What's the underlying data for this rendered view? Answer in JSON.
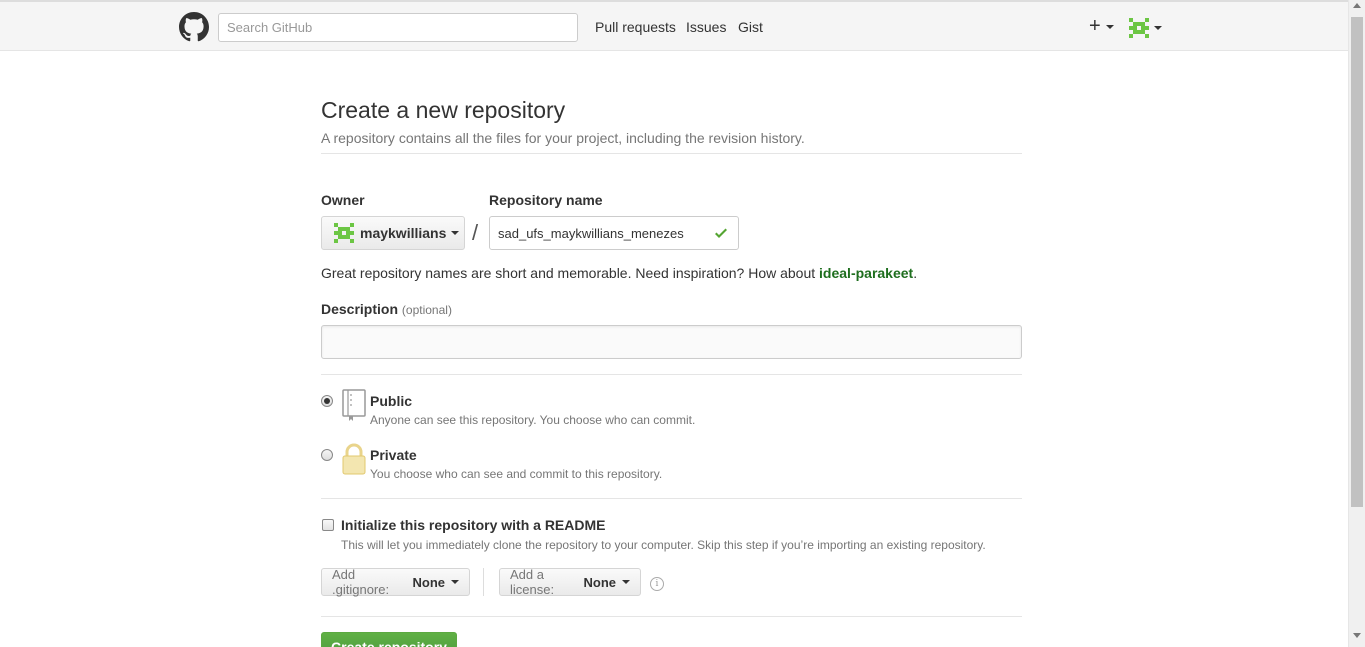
{
  "header": {
    "search_placeholder": "Search GitHub",
    "nav": [
      "Pull requests",
      "Issues",
      "Gist"
    ],
    "plus_label": "+"
  },
  "page": {
    "title": "Create a new repository",
    "subtitle": "A repository contains all the files for your project, including the revision history."
  },
  "owner": {
    "label": "Owner",
    "value": "maykwillians"
  },
  "repo": {
    "label": "Repository name",
    "value": "sad_ufs_maykwillians_menezes",
    "separator": "/"
  },
  "hint": {
    "text": "Great repository names are short and memorable. Need inspiration? How about ",
    "suggestion": "ideal-parakeet",
    "end": "."
  },
  "description": {
    "label": "Description",
    "optional": "(optional)",
    "value": ""
  },
  "visibility": {
    "selected": "public",
    "public": {
      "title": "Public",
      "note": "Anyone can see this repository. You choose who can commit."
    },
    "private": {
      "title": "Private",
      "note": "You choose who can see and commit to this repository."
    }
  },
  "readme": {
    "checked": false,
    "title": "Initialize this repository with a README",
    "note": "This will let you immediately clone the repository to your computer. Skip this step if you’re importing an existing repository."
  },
  "gitignore": {
    "label": "Add .gitignore:",
    "value": "None"
  },
  "license": {
    "label": "Add a license:",
    "value": "None"
  },
  "info_glyph": "i",
  "create_button": {
    "label": "Create repository"
  },
  "colors": {
    "accent_green": "#6cc644",
    "suggestion_green": "#1e6e1e",
    "button_green": "#55a532"
  },
  "icons": [
    "github-logo-icon",
    "plus-icon",
    "identicon-icon",
    "check-icon",
    "repo-icon",
    "lock-icon",
    "info-icon"
  ]
}
